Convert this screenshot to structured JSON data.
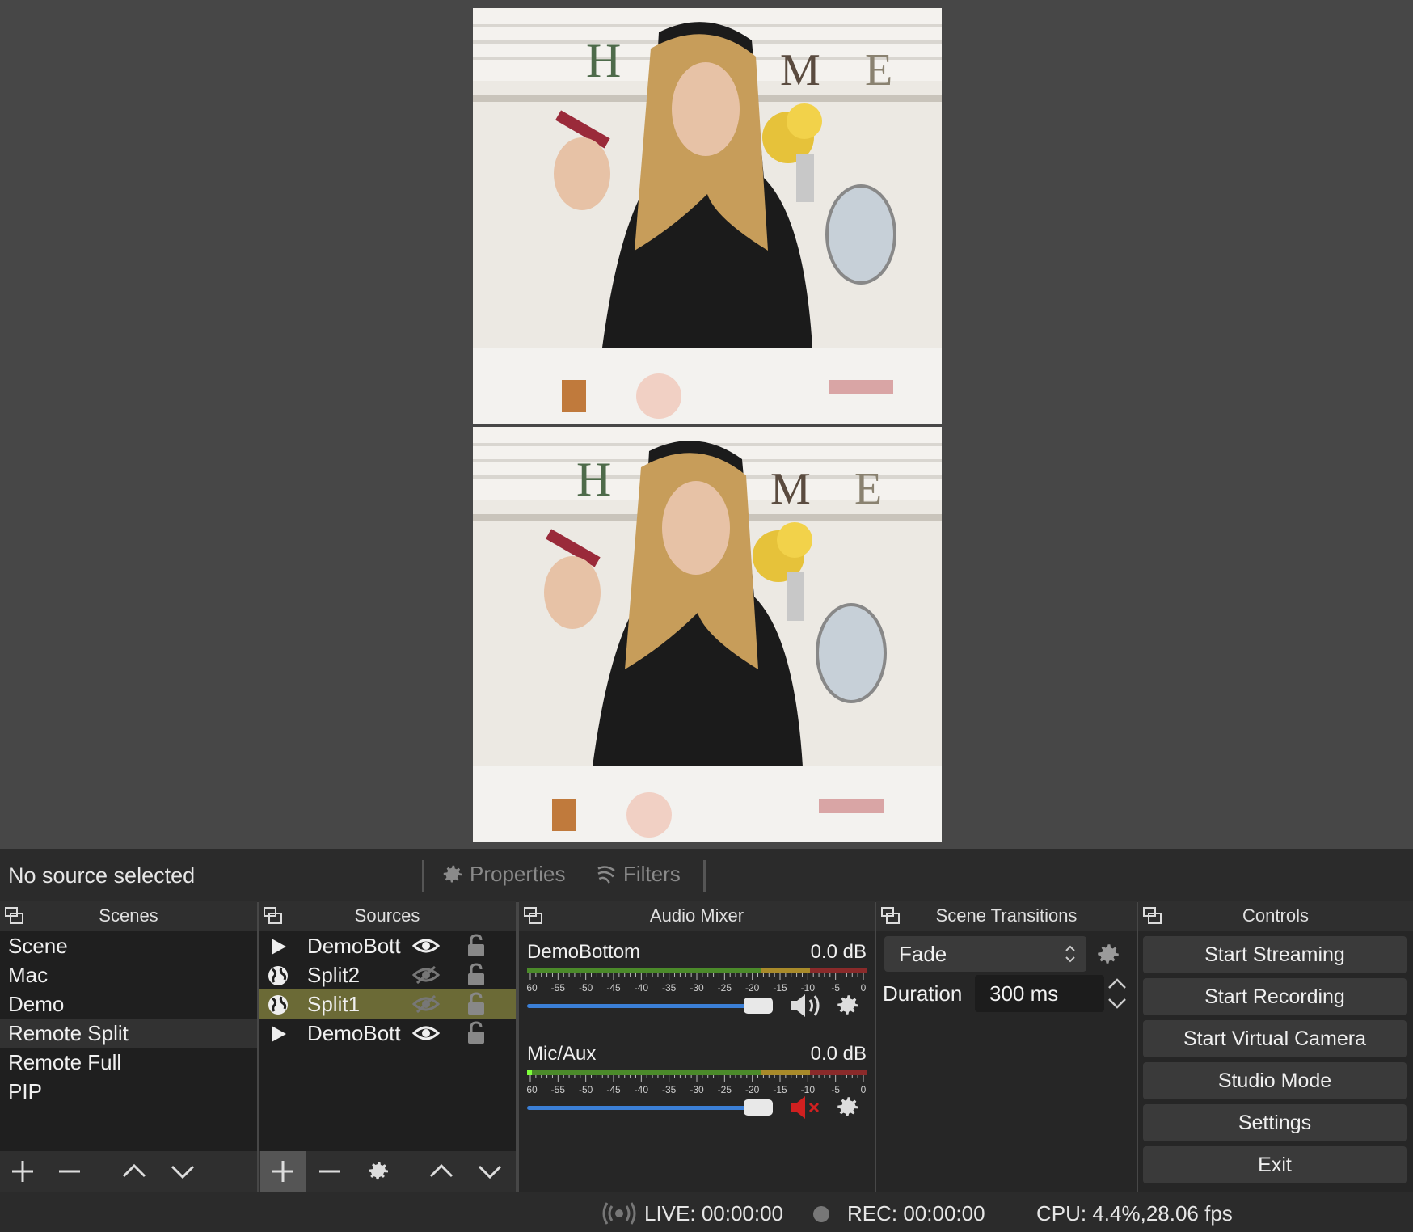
{
  "source_bar": {
    "selection_label": "No source selected",
    "properties_label": "Properties",
    "filters_label": "Filters"
  },
  "scenes": {
    "title": "Scenes",
    "items": [
      "Scene",
      "Mac",
      "Demo",
      "Remote Split",
      "Remote Full",
      "PIP"
    ],
    "selected_index": 3
  },
  "sources": {
    "title": "Sources",
    "items": [
      {
        "name": "DemoBott",
        "type": "media-icon",
        "visible": true,
        "locked": false
      },
      {
        "name": "Split2",
        "type": "browser-icon",
        "visible": false,
        "locked": false
      },
      {
        "name": "Split1",
        "type": "browser-icon",
        "visible": false,
        "locked": false
      },
      {
        "name": "DemoBott",
        "type": "media-icon",
        "visible": true,
        "locked": false
      }
    ],
    "selected_index": 2
  },
  "mixer": {
    "title": "Audio Mixer",
    "scale": [
      "-60",
      "-55",
      "-50",
      "-45",
      "-40",
      "-35",
      "-30",
      "-25",
      "-20",
      "-15",
      "-10",
      "-5",
      "0"
    ],
    "channels": [
      {
        "name": "DemoBottom",
        "db": "0.0 dB",
        "muted": false,
        "volume": 1.0
      },
      {
        "name": "Mic/Aux",
        "db": "0.0 dB",
        "muted": true,
        "volume": 1.0
      }
    ]
  },
  "transitions": {
    "title": "Scene Transitions",
    "selected": "Fade",
    "duration_label": "Duration",
    "duration_value": "300 ms"
  },
  "controls": {
    "title": "Controls",
    "buttons": [
      "Start Streaming",
      "Start Recording",
      "Start Virtual Camera",
      "Studio Mode",
      "Settings",
      "Exit"
    ]
  },
  "status": {
    "live": "LIVE: 00:00:00",
    "rec": "REC: 00:00:00",
    "cpu": "CPU: 4.4%,28.06 fps"
  },
  "colors": {
    "background": "#474747",
    "panel": "#1f1f1f",
    "selected_source": "#6b6a36",
    "volume_slider": "#3b7fd6",
    "muted": "#d02020"
  }
}
